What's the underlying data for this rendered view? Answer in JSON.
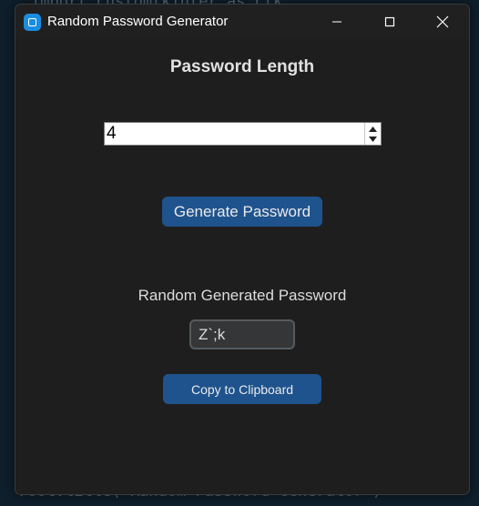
{
  "background": {
    "code_line_top": "import customtkinter as ctk",
    "code_line_bottom": "root.title(\"Random Password Generator\")"
  },
  "window": {
    "title": "Random Password Generator",
    "minimize_icon": "minimize-icon",
    "maximize_icon": "maximize-icon",
    "close_icon": "close-icon"
  },
  "main": {
    "heading": "Password Length",
    "length_value": "4",
    "generate_label": "Generate Password",
    "result_label": "Random Generated Password",
    "result_value": "Z`;k",
    "copy_label": "Copy to Clipboard"
  },
  "colors": {
    "accent": "#1f538d",
    "window_bg": "#1e1e1e",
    "field_bg": "#343638"
  }
}
